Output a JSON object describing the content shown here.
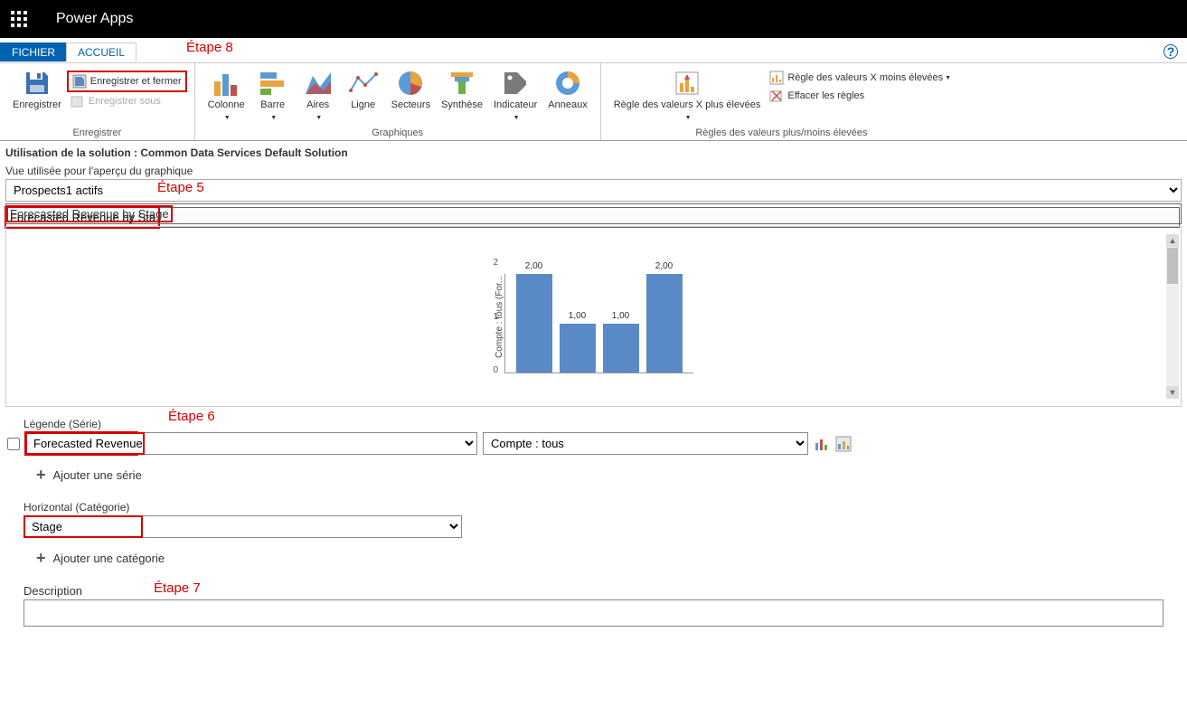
{
  "header": {
    "app_title": "Power Apps"
  },
  "tabs": {
    "file": "FICHIER",
    "home": "ACCUEIL"
  },
  "annotations": {
    "step5": "Étape 5",
    "step6": "Étape 6",
    "step7": "Étape 7",
    "step8": "Étape 8"
  },
  "ribbon": {
    "save_group_label": "Enregistrer",
    "charts_group_label": "Graphiques",
    "rules_group_label": "Règles des valeurs plus/moins élevées",
    "save": "Enregistrer",
    "save_close": "Enregistrer et fermer",
    "save_as": "Enregistrer sous",
    "column": "Colonne",
    "bar": "Barre",
    "area": "Aires",
    "line": "Ligne",
    "pie": "Secteurs",
    "funnel": "Synthèse",
    "indicator": "Indicateur",
    "donut": "Anneaux",
    "top_x": "Règle des valeurs X plus élevées",
    "bottom_x": "Règle des valeurs X moins élevées",
    "clear_rules": "Effacer les règles"
  },
  "content": {
    "solution_label": "Utilisation de la solution : Common Data Services Default Solution",
    "view_label": "Vue utilisée pour l'aperçu du graphique",
    "view_value": "Prospects1 actifs",
    "chart_title": "Forecasted Revenue by Stage"
  },
  "chart_data": {
    "type": "bar",
    "ylabel": "Compte : tous (For...",
    "categories": [
      "",
      "",
      "",
      ""
    ],
    "values": [
      2.0,
      1.0,
      1.0,
      2.0
    ],
    "data_labels": [
      "2,00",
      "1,00",
      "1,00",
      "2,00"
    ],
    "yticks": [
      "2",
      "1",
      "0"
    ],
    "ylim": [
      0,
      2
    ]
  },
  "designer": {
    "legend_label": "Légende (Série)",
    "series_field": "Forecasted Revenue",
    "series_aggregate": "Compte : tous",
    "add_series": "Ajouter une série",
    "horizontal_label": "Horizontal (Catégorie)",
    "category_field": "Stage",
    "add_category": "Ajouter une catégorie",
    "description_label": "Description"
  }
}
